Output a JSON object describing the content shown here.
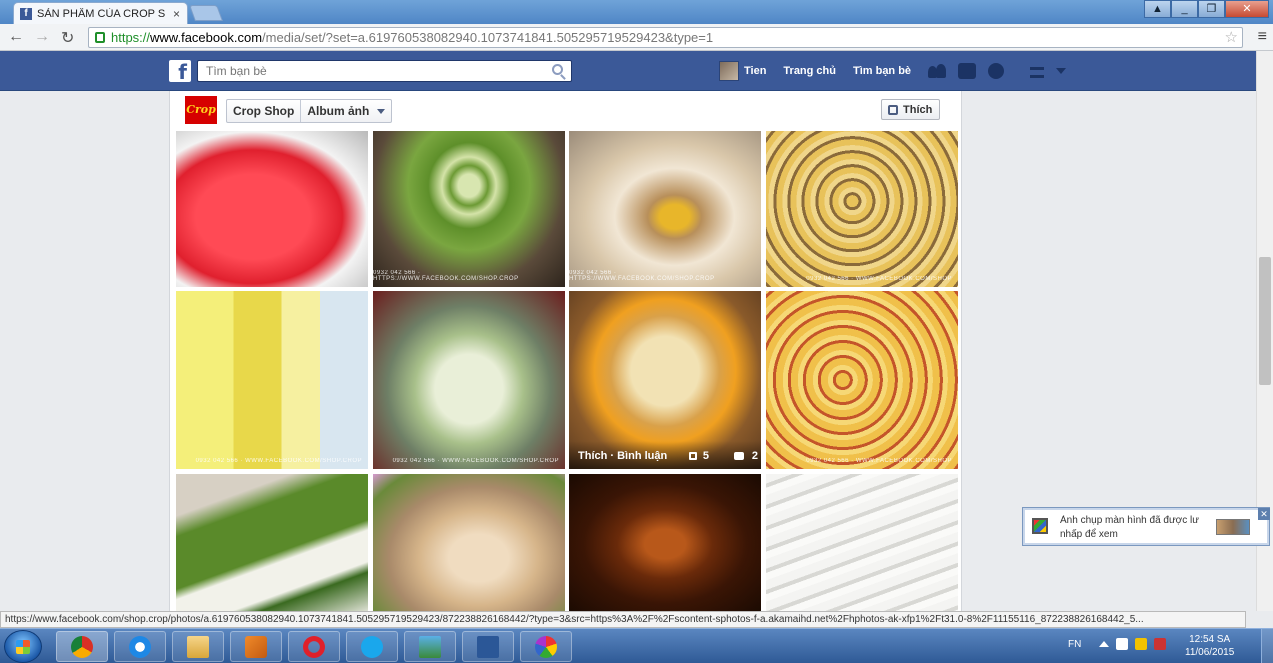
{
  "browser": {
    "tab_title": "SẢN PHẨM CỦA CROP SH",
    "tab_close": "×",
    "url": {
      "scheme": "https://",
      "host": "www.facebook.com",
      "path": "/media/set/?set=a.619760538082940.1073741841.505295719529423&type=1"
    },
    "back": "←",
    "forward": "→",
    "reload": "↻",
    "star": "☆",
    "menu": "≡",
    "window_buttons": [
      "▲",
      "_",
      "❐",
      "✕"
    ]
  },
  "facebook": {
    "logo": "f",
    "search_placeholder": "Tìm bạn bè",
    "nav": {
      "profile_name": "Tien",
      "home": "Trang chủ",
      "find_friends": "Tìm bạn bè"
    }
  },
  "album": {
    "page_thumb_text": "Crop",
    "page_name": "Crop Shop",
    "album_label": "Album ảnh",
    "like_button": "Thích",
    "photos": [
      {
        "caption": ""
      },
      {
        "caption": "0932 042 566 · HTTPS://WWW.FACEBOOK.COM/SHOP.CROP"
      },
      {
        "caption": "0932 042 566 · HTTPS://WWW.FACEBOOK.COM/SHOP.CROP"
      },
      {
        "caption": "0932 042 566 · WWW.FACEBOOK.COM/SHOP"
      },
      {
        "caption": "0932 042 566 · WWW.FACEBOOK.COM/SHOP.CROP"
      },
      {
        "caption": "0932 042 566 · WWW.FACEBOOK.COM/SHOP.CROP"
      },
      {
        "caption": ""
      },
      {
        "caption": "0932 042 566 · WWW.FACEBOOK.COM/SHOP"
      },
      {
        "caption": ""
      },
      {
        "caption": ""
      },
      {
        "caption": ""
      },
      {
        "caption": ""
      }
    ],
    "hover_overlay": {
      "actions": "Thích · Bình luận",
      "likes": "5",
      "comments": "2"
    }
  },
  "status_url": "https://www.facebook.com/shop.crop/photos/a.619760538082940.1073741841.505295719529423/872238826168442/?type=3&src=https%3A%2F%2Fscontent-sphotos-f-a.akamaihd.net%2Fhphotos-ak-xfp1%2Ft31.0-8%2F11155116_872238826168442_5...",
  "toast": {
    "title": "Ảnh chụp màn hình đã được lư",
    "subtitle": "nhấp để xem",
    "close": "✕"
  },
  "taskbar": {
    "language": "FN",
    "time": "12:54 SA",
    "date": "11/06/2015"
  },
  "colors": {
    "facebook_blue": "#3b5998",
    "taskbar_blue": "#2f5a96"
  }
}
